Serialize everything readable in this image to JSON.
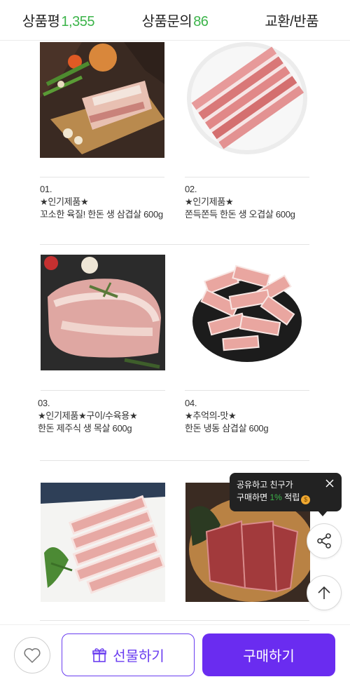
{
  "tabs": [
    {
      "label": "상품평",
      "count": "1,355"
    },
    {
      "label": "상품문의",
      "count": "86"
    },
    {
      "label": "교환/반품",
      "count": ""
    }
  ],
  "products": [
    {
      "no": "01.",
      "badge": "★인기제품★",
      "name": "꼬소한 육질! 한돈 생 삼겹살 600g"
    },
    {
      "no": "02.",
      "badge": "★인기제품★",
      "name": "쫀득쫀득 한돈 생 오겹살 600g"
    },
    {
      "no": "03.",
      "badge": "★인기제품★구이/수육용★",
      "name": "한돈 제주식 생 목살 600g"
    },
    {
      "no": "04.",
      "badge": "★추억의-맛★",
      "name": "한돈 냉동 삼겹살 600g"
    }
  ],
  "tooltip": {
    "line1": "공유하고 친구가",
    "line2_pre": "구매하면 ",
    "percent": "1%",
    "line2_post": " 적립"
  },
  "bottom": {
    "gift_label": "선물하기",
    "buy_label": "구매하기"
  },
  "colors": {
    "accent": "#6a2cf0",
    "count_green": "#3cb44a"
  },
  "icons": [
    "heart-icon",
    "gift-icon",
    "share-icon",
    "arrow-up-icon",
    "close-icon",
    "coin-icon"
  ]
}
